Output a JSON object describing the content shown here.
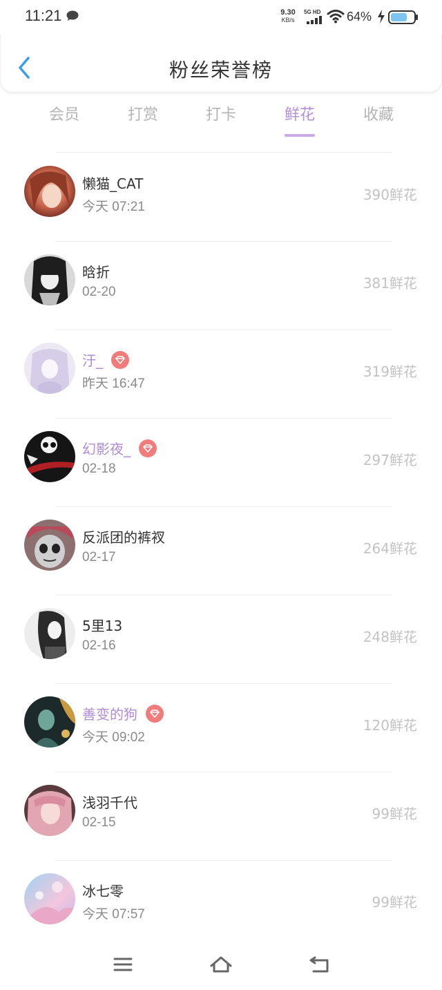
{
  "status_bar": {
    "time": "11:21",
    "speed_value": "9.30",
    "speed_unit": "KB/s",
    "network": "5G HD",
    "battery_percent": "64%"
  },
  "header": {
    "title": "粉丝荣誉榜",
    "back_icon": "chevron-left-icon"
  },
  "tabs": [
    {
      "label": "会员",
      "active": false
    },
    {
      "label": "打赏",
      "active": false
    },
    {
      "label": "打卡",
      "active": false
    },
    {
      "label": "鲜花",
      "active": true
    },
    {
      "label": "收藏",
      "active": false
    }
  ],
  "fans": [
    {
      "name": "懒猫_CAT",
      "time": "今天 07:21",
      "count": "390鲜花",
      "vip": false
    },
    {
      "name": "晗折",
      "time": "02-20",
      "count": "381鲜花",
      "vip": false
    },
    {
      "name": "汙_",
      "time": "昨天 16:47",
      "count": "319鲜花",
      "vip": true
    },
    {
      "name": "幻影夜_",
      "time": "02-18",
      "count": "297鲜花",
      "vip": true
    },
    {
      "name": "反派团的裤衩",
      "time": "02-17",
      "count": "264鲜花",
      "vip": false
    },
    {
      "name": "5里13",
      "time": "02-16",
      "count": "248鲜花",
      "vip": false
    },
    {
      "name": "善变的狗",
      "time": "今天 09:02",
      "count": "120鲜花",
      "vip": true
    },
    {
      "name": "浅羽千代",
      "time": "02-15",
      "count": "99鲜花",
      "vip": false
    },
    {
      "name": "冰七零",
      "time": "今天 07:57",
      "count": "99鲜花",
      "vip": false
    }
  ],
  "colors": {
    "accent": "#b490d8",
    "vip_name": "#b08bd6",
    "badge": "#f07c7c",
    "back_arrow": "#3a9ee8"
  },
  "nav_bar": {
    "icons": [
      "menu-icon",
      "home-icon",
      "back-icon"
    ]
  }
}
